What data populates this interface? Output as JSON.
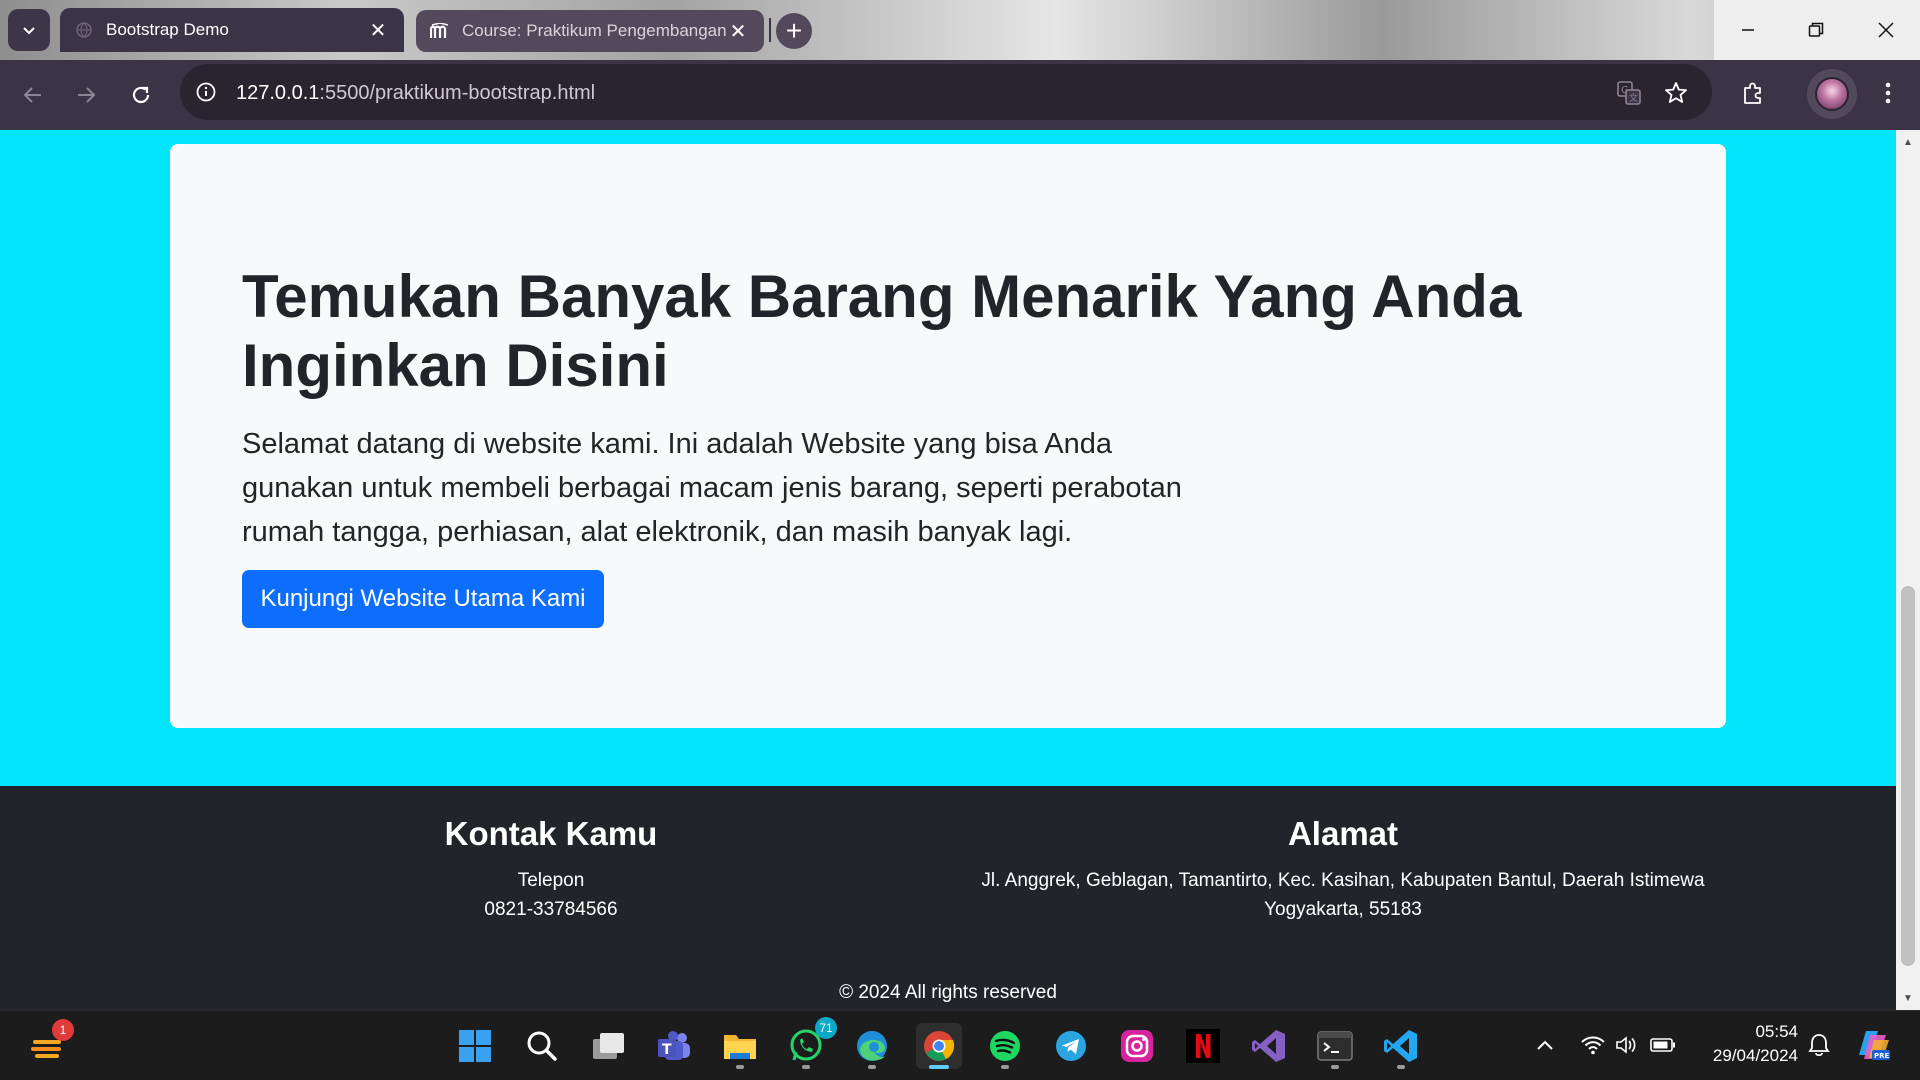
{
  "browser": {
    "tabs": [
      {
        "title": "Bootstrap Demo",
        "active": true,
        "favicon": "globe-icon"
      },
      {
        "title": "Course: Praktikum Pengembangan",
        "active": false,
        "favicon": "moodle-m-icon"
      }
    ],
    "url": {
      "host": "127.0.0.1",
      "rest": ":5500/praktikum-bootstrap.html"
    },
    "colors": {
      "frame": "#3b3446",
      "omnibox": "#2a2430"
    }
  },
  "page": {
    "hero": {
      "heading": "Temukan Banyak Barang Menarik Yang Anda Inginkan Disini",
      "lead": "Selamat datang di website kami. Ini adalah Website yang bisa Anda gunakan untuk membeli berbagai macam jenis barang, seperti perabotan rumah tangga, perhiasan, alat elektronik, dan masih banyak lagi.",
      "button_label": "Kunjungi Website Utama Kami"
    },
    "footer": {
      "contact": {
        "title": "Kontak Kamu",
        "label": "Telepon",
        "phone": "0821-33784566"
      },
      "address": {
        "title": "Alamat",
        "line1": "Jl. Anggrek, Geblagan, Tamantirto, Kec. Kasihan, Kabupaten Bantul, Daerah Istimewa",
        "line2": "Yogyakarta, 55183"
      },
      "copyright": "© 2024 All rights reserved"
    },
    "colors": {
      "background": "#00e5fa",
      "card": "#f8f9fa",
      "primary": "#0d6efd",
      "footer": "#212529"
    }
  },
  "taskbar": {
    "widget_badge": "1",
    "whatsapp_badge": "71",
    "apps": [
      "windows-start-icon",
      "search-icon",
      "task-view-icon",
      "teams-icon",
      "file-explorer-icon",
      "whatsapp-icon",
      "edge-icon",
      "chrome-icon",
      "spotify-icon",
      "telegram-icon",
      "instagram-icon",
      "netflix-icon",
      "visual-studio-icon",
      "terminal-icon",
      "vscode-icon"
    ],
    "time": "05:54",
    "date": "29/04/2024"
  }
}
